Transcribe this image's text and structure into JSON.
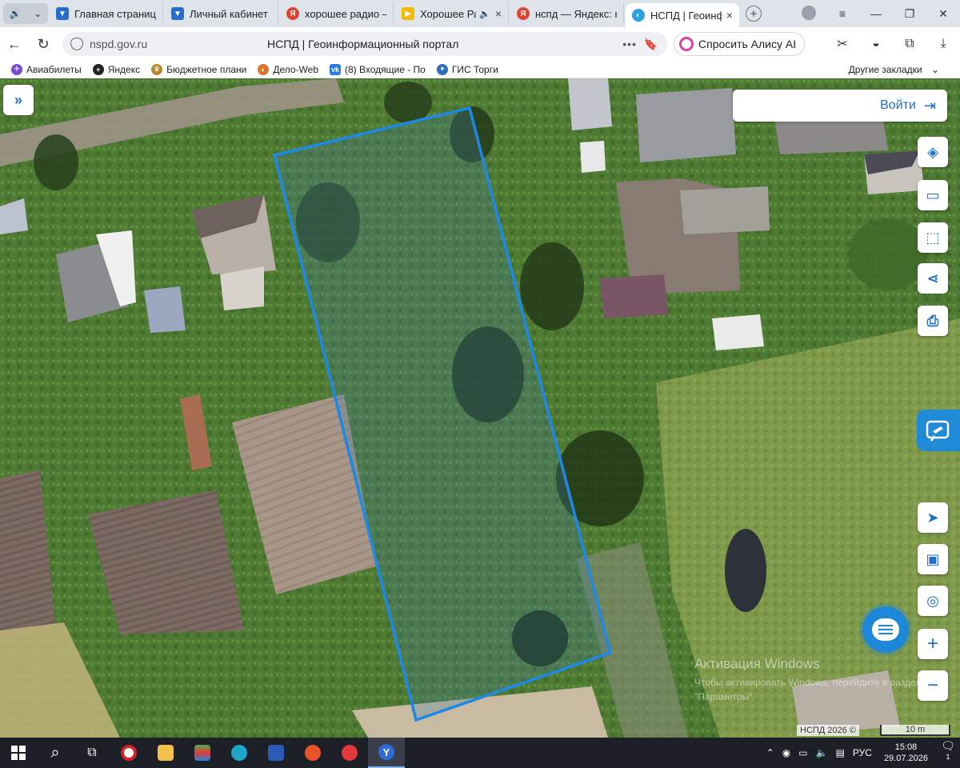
{
  "browser": {
    "tabs": [
      {
        "title": "Главная страница",
        "favicon": "gosuslugi-icon",
        "color": "#2b6bc9"
      },
      {
        "title": "Личный кабинет",
        "favicon": "gosuslugi-icon",
        "color": "#2b6bc9"
      },
      {
        "title": "хорошее радио –",
        "favicon": "yandex-icon",
        "color": "#e3412f"
      },
      {
        "title": "Хорошее Ра",
        "favicon": "play-icon",
        "color": "#f5b800"
      },
      {
        "title": "нспд — Яндекс: н",
        "favicon": "yandex-icon",
        "color": "#e3412f"
      },
      {
        "title": "НСПД | Геоинф",
        "favicon": "nspd-icon",
        "color": "#2aa1e0",
        "active": true
      }
    ],
    "url": "nspd.gov.ru",
    "page_title": "НСПД | Геоинформационный портал",
    "alice_label": "Спросить Алису AI",
    "bookmarks": [
      {
        "label": "Авиабилеты",
        "color": "#7a4bd1"
      },
      {
        "label": "Яндекс",
        "color": "#222"
      },
      {
        "label": "Бюджетное плани",
        "color": "#b8862e"
      },
      {
        "label": "Дело-Web",
        "color": "#d9762b"
      },
      {
        "label": "(8) Входящие - По",
        "color": "#2c7be5"
      },
      {
        "label": "ГИС Торги",
        "color": "#2c6fb8"
      }
    ],
    "other_bookmarks": "Другие закладки"
  },
  "map": {
    "login_label": "Войти",
    "watermark_title": "Активация Windows",
    "watermark_text": "Чтобы активировать Windows, перейдите в раздел \"Параметры\".",
    "copyright": "НСПД 2026 ©",
    "scale_label": "10 m",
    "parcel_color": "#1e88e5"
  },
  "taskbar": {
    "language": "РУС",
    "time": "15:08",
    "date": "29.07.2026",
    "notifications": "1"
  }
}
